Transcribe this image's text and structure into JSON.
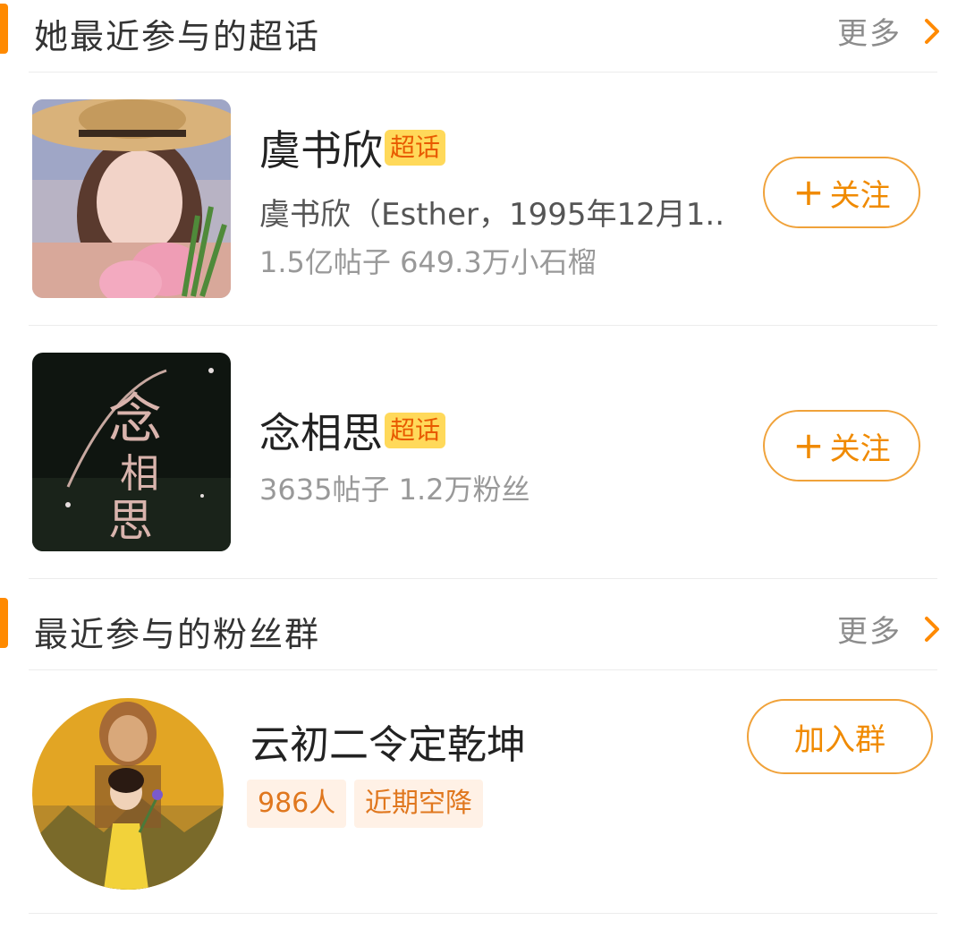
{
  "supertopics": {
    "section_title": "她最近参与的超话",
    "more_label": "更多",
    "items": [
      {
        "name": "虞书欣",
        "badge": "超话",
        "description": "虞书欣（Esther，1995年12月1...",
        "stats": "1.5亿帖子 649.3万小石榴",
        "follow_label": "关注"
      },
      {
        "name": "念相思",
        "badge": "超话",
        "stats": "3635帖子 1.2万粉丝",
        "follow_label": "关注",
        "cover_text": "念相思"
      }
    ]
  },
  "fan_groups": {
    "section_title": "最近参与的粉丝群",
    "more_label": "更多",
    "items": [
      {
        "name": "云初二令定乾坤",
        "chips": [
          "986人",
          "近期空降"
        ],
        "join_label": "加入群"
      }
    ]
  },
  "icons": {
    "chevron": "chevron-right-icon",
    "plus": "plus-icon"
  },
  "colors": {
    "accent": "#ff8a00",
    "button_text": "#f08a00",
    "badge_bg": "#ffd95a",
    "chip_bg": "#fff1e6"
  }
}
